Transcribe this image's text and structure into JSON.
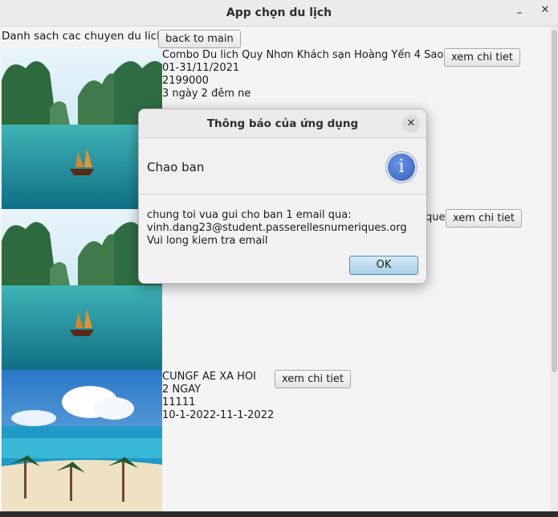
{
  "window": {
    "title": "App chọn du lịch",
    "minimize_glyph": "–",
    "maximize_glyph": "▫",
    "close_glyph": "✕"
  },
  "page": {
    "heading": "Danh sach cac chuyen du lich",
    "back_label": "back to main"
  },
  "trips": [
    {
      "image": "ha-long-bay-image",
      "lines": [
        "Combo Du lich Quy Nhơn Khách sạn Hoàng Yến 4 Sao",
        "01-31/11/2021",
        "2199000",
        "3 ngày 2 đêm ne"
      ],
      "button_label": "xem chi tiet"
    },
    {
      "image": "ha-long-bay-image",
      "lines": [
        "que"
      ],
      "button_label": "xem chi tiet"
    },
    {
      "image": "tropical-beach-image",
      "lines": [
        "CUNGF AE XA HOI",
        "2 NGAY",
        "11111",
        "10-1-2022-11-1-2022"
      ],
      "button_label": "xem chi tiet"
    }
  ],
  "dialog": {
    "title": "Thông báo của ứng dụng",
    "close_glyph": "✕",
    "header": "Chao ban",
    "icon": "info-icon",
    "icon_glyph": "i",
    "message": [
      "chung toi vua gui cho ban 1 email qua:",
      "vinh.dang23@student.passerellesnumeriques.org",
      "Vui long kiem tra email"
    ],
    "ok_label": "OK"
  }
}
